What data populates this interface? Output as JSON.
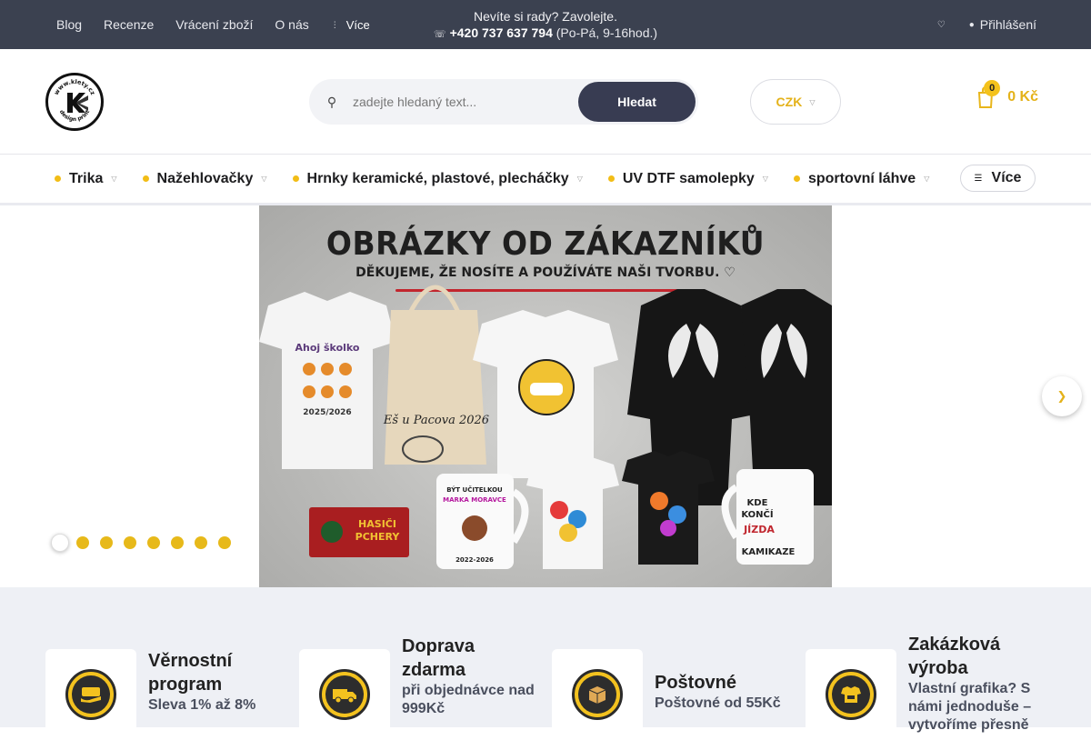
{
  "topbar": {
    "links": [
      "Blog",
      "Recenze",
      "Vrácení zboží",
      "O nás"
    ],
    "more_label": "Více",
    "contact_question": "Nevíte si rady? Zavolejte.",
    "phone": "+420 737 637 794",
    "hours": "(Po-Pá, 9-16hod.)",
    "login_label": "Přihlášení"
  },
  "header": {
    "search_placeholder": "zadejte hledaný text...",
    "search_button": "Hledat",
    "currency": "CZK",
    "cart_count": "0",
    "cart_total": "0 Kč",
    "logo_text": "www.klety.cz design print"
  },
  "categories": [
    {
      "label": "Trika"
    },
    {
      "label": "Nažehlovačky"
    },
    {
      "label": "Hrnky keramické, plastové, plecháčky"
    },
    {
      "label": "UV DTF samolepky"
    },
    {
      "label": "sportovní láhve"
    }
  ],
  "categories_more": "Více",
  "banner": {
    "title": "OBRÁZKY OD ZÁKAZNÍKŮ",
    "subtitle": "DĚKUJEME, ŽE NOSÍTE A POUŽÍVÁTE NAŠI TVORBU. ♡",
    "slide_count": 8,
    "active_slide": 1
  },
  "benefits": [
    {
      "title": "Věrnostní program",
      "subtitle": "Sleva 1% až 8%",
      "icon": "loyalty-icon"
    },
    {
      "title": "Doprava zdarma",
      "subtitle": "při objednávce nad 999Kč",
      "icon": "truck-icon"
    },
    {
      "title": "Poštovné",
      "subtitle": "Poštovné od 55Kč",
      "icon": "box-icon"
    },
    {
      "title": "Zakázková výroba",
      "subtitle": "Vlastní grafika? S námi jednoduše – vytvoříme přesně",
      "icon": "custom-icon"
    }
  ],
  "colors": {
    "topbar_bg": "#3b4150",
    "accent_yellow": "#f2bd16",
    "button_dark": "#383c52",
    "benefits_bg": "#eef0f5"
  }
}
